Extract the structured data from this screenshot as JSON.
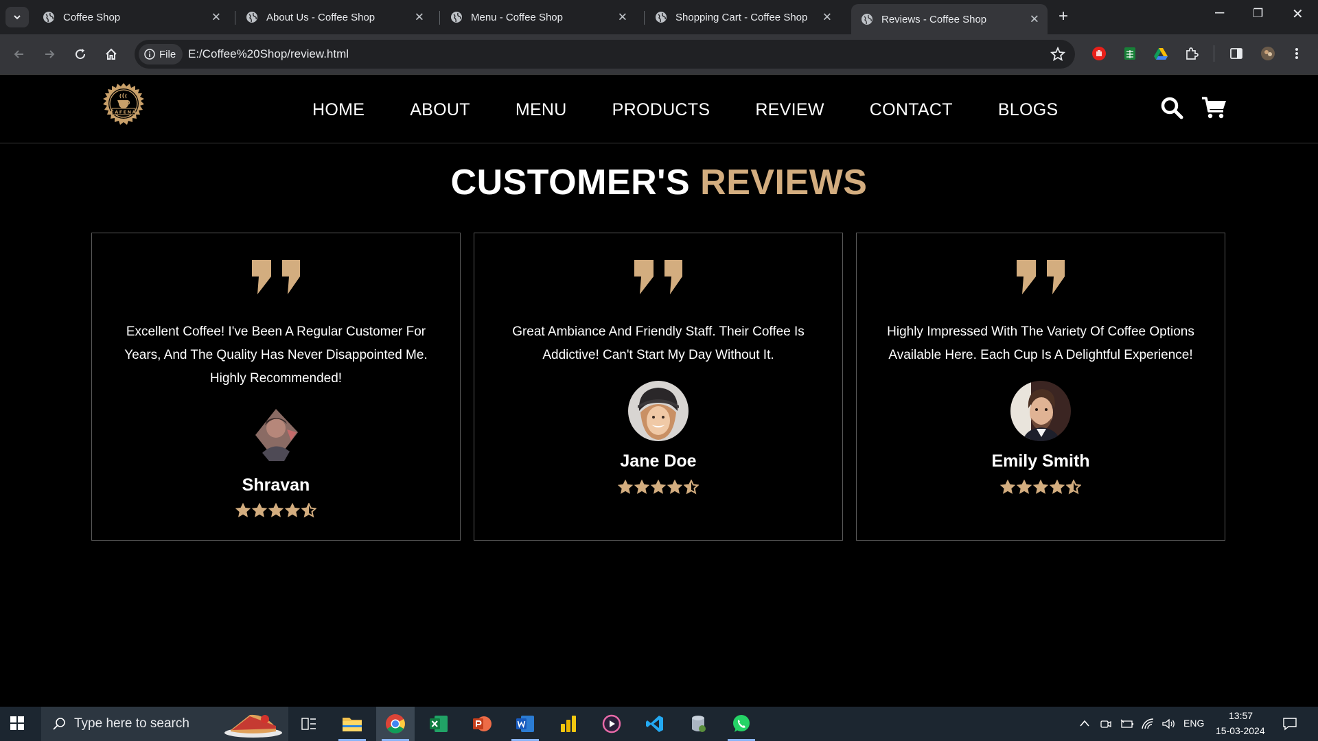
{
  "browser": {
    "tabs": [
      {
        "title": "Coffee Shop",
        "active": false
      },
      {
        "title": "About Us - Coffee Shop",
        "active": false
      },
      {
        "title": "Menu - Coffee Shop",
        "active": false
      },
      {
        "title": "Shopping Cart - Coffee Shop",
        "active": false
      },
      {
        "title": "Reviews - Coffee Shop",
        "active": true
      }
    ],
    "address": {
      "scheme_label": "File",
      "url": "E:/Coffee%20Shop/review.html"
    }
  },
  "site": {
    "logo_text": "CAFENA",
    "nav": [
      "HOME",
      "ABOUT",
      "MENU",
      "PRODUCTS",
      "REVIEW",
      "CONTACT",
      "BLOGS"
    ],
    "heading": {
      "main": "CUSTOMER'S",
      "accent": "REVIEWS"
    },
    "accent_color": "#d3ad7f",
    "reviews": [
      {
        "text": "Excellent Coffee! I've Been A Regular Customer For Years, And The Quality Has Never Disappointed Me. Highly Recommended!",
        "name": "Shravan",
        "rating": 4.5
      },
      {
        "text": "Great Ambiance And Friendly Staff. Their Coffee Is Addictive! Can't Start My Day Without It.",
        "name": "Jane Doe",
        "rating": 4.5
      },
      {
        "text": "Highly Impressed With The Variety Of Coffee Options Available Here. Each Cup Is A Delightful Experience!",
        "name": "Emily Smith",
        "rating": 4.5
      }
    ]
  },
  "taskbar": {
    "search_placeholder": "Type here to search",
    "language": "ENG",
    "time": "13:57",
    "date": "15-03-2024"
  }
}
